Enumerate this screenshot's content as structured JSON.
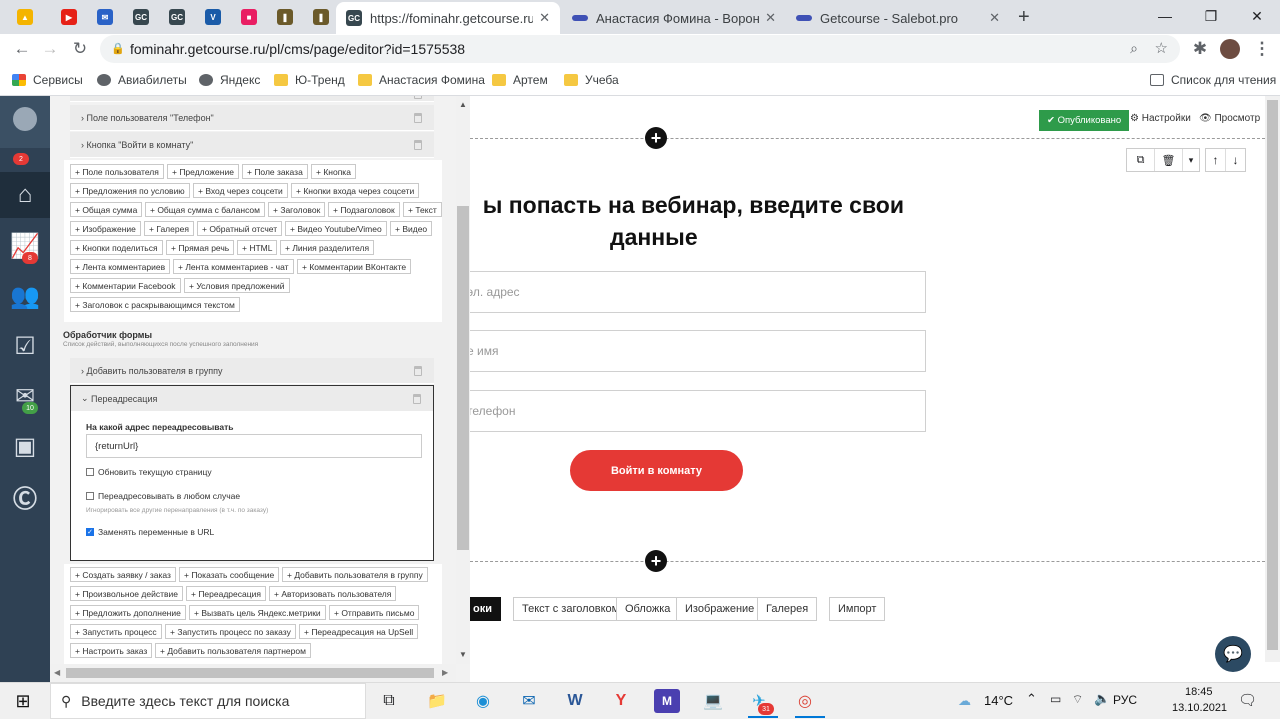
{
  "browser": {
    "pinned_tabs": [
      {
        "icon": "google-drive-icon",
        "color": "#f4b400"
      },
      {
        "icon": "youtube-icon",
        "color": "#e62117"
      },
      {
        "icon": "mail-icon",
        "color": "#2a62c7"
      },
      {
        "icon": "getcourse-icon",
        "color": "#37474f"
      },
      {
        "icon": "getcourse-icon",
        "color": "#37474f"
      },
      {
        "icon": "vk-icon",
        "color": "#1a5ba8"
      },
      {
        "icon": "image-icon",
        "color": "#e91e63"
      },
      {
        "icon": "book-icon",
        "color": "#6b5a2a"
      },
      {
        "icon": "book-icon",
        "color": "#6b5a2a"
      }
    ],
    "tabs": [
      {
        "title": "https://fominahr.getcourse.ru/pl/c",
        "active": true
      },
      {
        "title": "Анастасия Фомина - Воронки",
        "active": false
      },
      {
        "title": "Getcourse - Salebot.pro",
        "active": false
      }
    ],
    "url": "fominahr.getcourse.ru/pl/cms/page/editor?id=1575538",
    "bookmarks": [
      {
        "label": "Сервисы",
        "icon": "apps-icon"
      },
      {
        "label": "Авиабилеты",
        "icon": "globe-icon"
      },
      {
        "label": "Яндекс",
        "icon": "globe-icon"
      },
      {
        "label": "Ю-Тренд",
        "icon": "folder-icon"
      },
      {
        "label": "Анастасия Фомина",
        "icon": "folder-icon"
      },
      {
        "label": "Артем",
        "icon": "folder-icon"
      },
      {
        "label": "Учеба",
        "icon": "folder-icon"
      }
    ],
    "reading_list": "Список для чтения"
  },
  "leftnav": {
    "badges": {
      "profile": "2",
      "stats": "8",
      "mail": "10"
    },
    "colors": {
      "red": "#e53935",
      "green": "#43a047"
    }
  },
  "editor": {
    "top_rows": [
      "Поле пользователя \"Телефон\"",
      "Кнопка \"Войти в комнату\""
    ],
    "block_chips": [
      "+ Поле пользователя",
      "+ Предложение",
      "+ Поле заказа",
      "+ Кнопка",
      "+ Предложения по условию",
      "+ Вход через соцсети",
      "+ Кнопки входа через соцсети",
      "+ Общая сумма",
      "+ Общая сумма с балансом",
      "+ Заголовок",
      "+ Подзаголовок",
      "+ Текст",
      "+ Изображение",
      "+ Галерея",
      "+ Обратный отсчет",
      "+ Видео Youtube/Vimeo",
      "+ Видео",
      "+ Кнопки поделиться",
      "+ Прямая речь",
      "+ HTML",
      "+ Линия разделителя",
      "+ Лента комментариев",
      "+ Лента комментариев - чат",
      "+ Комментарии ВКонтакте",
      "+ Комментарии Facebook",
      "+ Условия предложений",
      "+ Заголовок с раскрывающимся текстом"
    ],
    "handler_title": "Обработчик формы",
    "handler_sub": "Список действий, выполняющихся после успешного заполнения",
    "handler_rows": [
      "Добавить пользователя в группу"
    ],
    "redirect": {
      "title": "Переадресация",
      "label": "На какой адрес переадресовывать",
      "value": "{returnUrl}",
      "opt1": "Обновить текущую страницу",
      "opt2": "Переадресовывать в любом случае",
      "opt2_hint": "Игнорировать все другие перенаправления (в т.ч. по заказу)",
      "opt3": "Заменять переменные в URL",
      "opt1_checked": false,
      "opt2_checked": false,
      "opt3_checked": true
    },
    "action_chips": [
      "+ Создать заявку / заказ",
      "+ Показать сообщение",
      "+ Добавить пользователя в группу",
      "+ Произвольное действие",
      "+ Переадресация",
      "+ Авторизовать пользователя",
      "+ Предложить дополнение",
      "+ Вызвать цель Яндекс.метрики",
      "+ Отправить письмо",
      "+ Запустить процесс",
      "+ Запустить процесс по заказу",
      "+ Переадресация на UpSell",
      "+ Настроить заказ",
      "+ Добавить пользователя партнером"
    ]
  },
  "preview": {
    "published": "✔ Опубликовано",
    "settings": "Настройки",
    "view": "Просмотр",
    "heading_line1": "ы попасть на вебинар, введите свои",
    "heading_line2": "данные",
    "fields": [
      "эл. адрес",
      "е имя",
      "телефон"
    ],
    "submit": "Войти в комнату",
    "submit_color": "#e53935",
    "block_tabs": [
      "оки",
      "Текст с заголовком",
      "Обложка",
      "Изображение",
      "Галерея"
    ],
    "import": "Импорт",
    "published_color": "#2e9b4a"
  },
  "taskbar": {
    "search_placeholder": "Введите здесь текст для поиска",
    "weather": "14°C",
    "lang": "РУС",
    "time": "18:45",
    "date": "13.10.2021",
    "telegram_badge": "31"
  }
}
